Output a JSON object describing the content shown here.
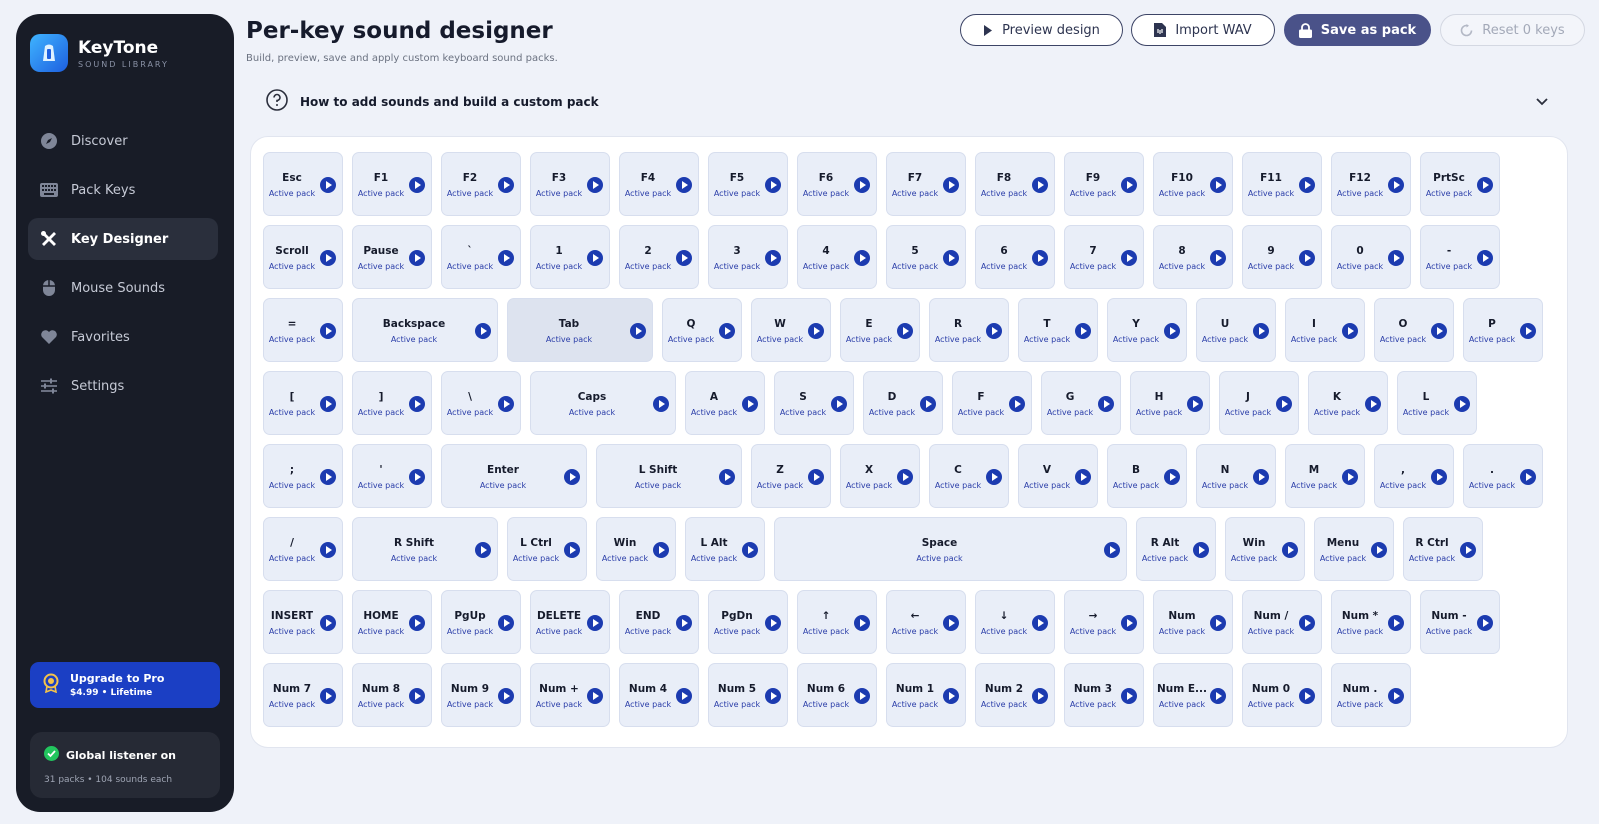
{
  "app": {
    "name": "KeyTone",
    "subtitle": "SOUND LIBRARY"
  },
  "nav": [
    {
      "label": "Discover",
      "icon": "compass-icon",
      "active": false
    },
    {
      "label": "Pack Keys",
      "icon": "keyboard-icon",
      "active": false
    },
    {
      "label": "Key Designer",
      "icon": "tools-icon",
      "active": true
    },
    {
      "label": "Mouse Sounds",
      "icon": "mouse-icon",
      "active": false
    },
    {
      "label": "Favorites",
      "icon": "heart-icon",
      "active": false
    },
    {
      "label": "Settings",
      "icon": "sliders-icon",
      "active": false
    }
  ],
  "upgrade": {
    "title": "Upgrade to Pro",
    "price": "$4.99 • Lifetime"
  },
  "listener": {
    "title": "Global listener on",
    "sub": "31 packs • 104 sounds each"
  },
  "header": {
    "title": "Per-key sound designer",
    "subtitle": "Build, preview, save and apply custom keyboard sound packs.",
    "preview_label": "Preview design",
    "import_label": "Import WAV",
    "save_label": "Save as pack",
    "reset_label": "Reset 0 keys"
  },
  "howto": {
    "title": "How to add sounds and build a custom pack"
  },
  "colors": {
    "accent": "#1c3bb0",
    "save": "#4a5289",
    "sidebar": "#181c27",
    "upgrade": "#1b3fc4",
    "listener_ok": "#22c55e"
  },
  "keyboard": {
    "pack_label": "Active pack",
    "selected_key": "Tab",
    "rows": [
      [
        "Esc",
        "F1",
        "F2",
        "F3",
        "F4",
        "F5",
        "F6",
        "F7",
        "F8",
        "F9",
        "F10",
        "F11",
        "F12",
        "PrtSc"
      ],
      [
        "Scroll",
        "Pause",
        "`",
        "1",
        "2",
        "3",
        "4",
        "5",
        "6",
        "7",
        "8",
        "9",
        "0",
        "-"
      ],
      [
        "=",
        "Backspace",
        "Tab",
        "Q",
        "W",
        "E",
        "R",
        "T",
        "Y",
        "U",
        "I",
        "O",
        "P"
      ],
      [
        "[",
        "]",
        "\\",
        "Caps",
        "A",
        "S",
        "D",
        "F",
        "G",
        "H",
        "J",
        "K",
        "L"
      ],
      [
        ";",
        "'",
        "Enter",
        "L Shift",
        "Z",
        "X",
        "C",
        "V",
        "B",
        "N",
        "M",
        ",",
        "."
      ],
      [
        "/",
        "R Shift",
        "L Ctrl",
        "Win",
        "L Alt",
        "Space",
        "R Alt",
        "Win",
        "Menu",
        "R Ctrl"
      ],
      [
        "INSERT",
        "HOME",
        "PgUp",
        "DELETE",
        "END",
        "PgDn",
        "↑",
        "←",
        "↓",
        "→",
        "Num",
        "Num /",
        "Num *",
        "Num -"
      ],
      [
        "Num 7",
        "Num 8",
        "Num 9",
        "Num +",
        "Num 4",
        "Num 5",
        "Num 6",
        "Num 1",
        "Num 2",
        "Num 3",
        "Num E...",
        "Num 0",
        "Num ."
      ]
    ]
  }
}
